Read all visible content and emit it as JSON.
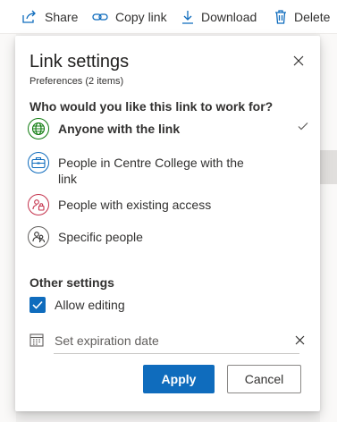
{
  "toolbar": {
    "share": "Share",
    "copy_link": "Copy link",
    "download": "Download",
    "delete": "Delete"
  },
  "dialog": {
    "title": "Link settings",
    "subtitle": "Preferences (2 items)",
    "question": "Who would you like this link to work for?",
    "options": [
      {
        "label": "Anyone with the link",
        "icon": "globe-icon",
        "selected": true
      },
      {
        "label": "People in Centre College with the link",
        "icon": "briefcase-icon",
        "selected": false
      },
      {
        "label": "People with existing access",
        "icon": "people-lock-icon",
        "selected": false
      },
      {
        "label": "Specific people",
        "icon": "people-icon",
        "selected": false
      }
    ],
    "other_settings": "Other settings",
    "allow_editing": "Allow editing",
    "allow_editing_checked": true,
    "expiration_placeholder": "Set expiration date",
    "apply": "Apply",
    "cancel": "Cancel"
  },
  "colors": {
    "accent": "#0f6cbd",
    "globe": "#107c10",
    "org": "#0f6cbd",
    "existing": "#c4314b"
  }
}
